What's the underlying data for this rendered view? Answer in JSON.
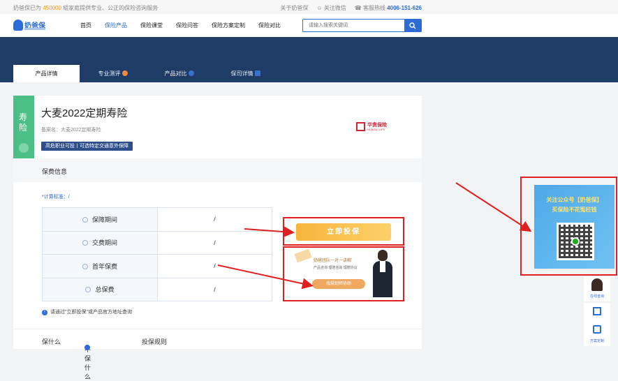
{
  "topbar": {
    "prefix": "奶爸保已为",
    "count": "450000",
    "suffix": "組家庭提供专业、公正的保险咨询服务",
    "about": "关于奶爸保",
    "wechat": "关注微信",
    "hotline_label": "客服热线",
    "hotline": "4006-151-626"
  },
  "nav": {
    "logo": "奶爸保",
    "items": [
      "首页",
      "保险产品",
      "保险课堂",
      "保险问答",
      "保险方案定制",
      "保险对比"
    ],
    "active_index": 1,
    "search_placeholder": "请输入搜索关键词"
  },
  "tabs": [
    "产品详情",
    "专业测评",
    "产品对比",
    "保司详情"
  ],
  "product": {
    "category": "寿险",
    "title": "大麦2022定期寿险",
    "record": "备案名：大麦2022定期寿险",
    "tag": "高危职业可投丨可选特定交通意外保障",
    "company": "华贵保险",
    "company_en": "HUAGUI LIFE"
  },
  "premium": {
    "section_title": "保费信息",
    "calc_label": "*计算标准：/",
    "rows": [
      {
        "label": "保障期间",
        "value": "/"
      },
      {
        "label": "交费期间",
        "value": "/"
      },
      {
        "label": "首年保费",
        "value": "/"
      },
      {
        "label": "总保费",
        "value": "/"
      }
    ],
    "note": "请通过\"立即投保\"或产品官方地址查询",
    "buy_button": "立即投保"
  },
  "consult": {
    "line1": "奶爸团队一对一讲解",
    "line2": "产品咨询   理赔咨询   理赔协议",
    "button": "找规划师协助"
  },
  "bottom_tabs": [
    "保什么",
    "不保什么",
    "投保规则"
  ],
  "qr": {
    "line1": "关注公众号【奶爸保】",
    "line2": "买保险不花冤枉钱"
  },
  "side": {
    "online": "在线咨询",
    "plan": "方案定制"
  }
}
